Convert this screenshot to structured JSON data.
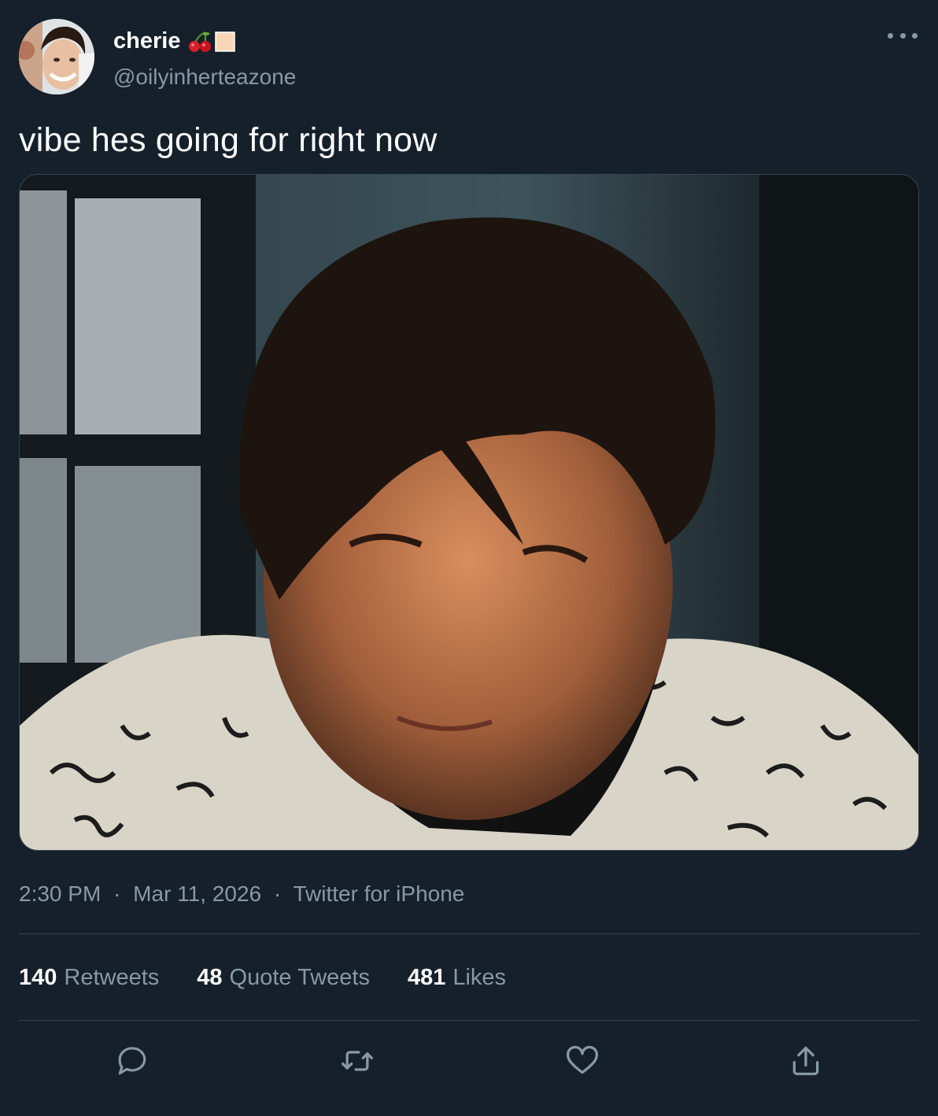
{
  "user": {
    "display_name": "cherie",
    "name_emojis": [
      "cherries-emoji",
      "skin-tone-swatch-emoji"
    ],
    "handle": "@oilyinherteazone"
  },
  "tweet": {
    "text": "vibe hes going for right now",
    "media_alt": "photo of a young man with messy dark hair looking down, wearing a patterned shirt, window in background"
  },
  "meta": {
    "time": "2:30 PM",
    "date": "Mar 11, 2026",
    "source": "Twitter for iPhone",
    "separator": "·"
  },
  "stats": {
    "retweets_count": "140",
    "retweets_label": "Retweets",
    "quotes_count": "48",
    "quotes_label": "Quote Tweets",
    "likes_count": "481",
    "likes_label": "Likes"
  },
  "icons": {
    "reply": "reply-icon",
    "retweet": "retweet-icon",
    "like": "heart-icon",
    "share": "share-icon",
    "more": "more-icon"
  },
  "colors": {
    "background": "#15202b",
    "secondary_text": "#8899a6",
    "border": "#38444d"
  }
}
